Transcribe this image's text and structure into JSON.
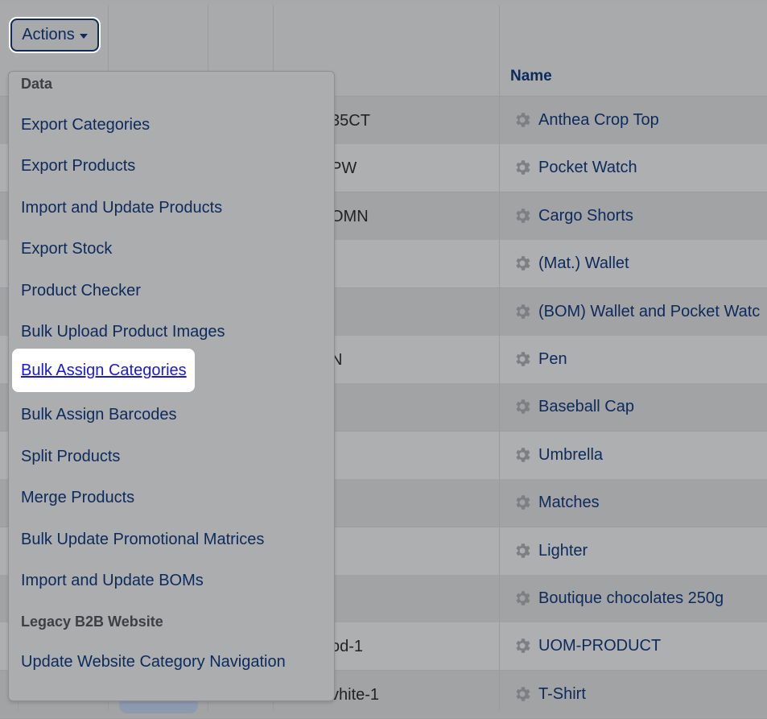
{
  "actions": {
    "label": "Actions"
  },
  "table": {
    "name_header": "Name",
    "rows": [
      {
        "sku": "35CT",
        "name": "Anthea Crop Top"
      },
      {
        "sku": "PW",
        "name": "Pocket Watch"
      },
      {
        "sku": "OMN",
        "name": "Cargo Shorts"
      },
      {
        "sku": "",
        "name": "(Mat.) Wallet"
      },
      {
        "sku": "",
        "name": "(BOM) Wallet and Pocket Watc"
      },
      {
        "sku": "N",
        "name": "Pen"
      },
      {
        "sku": "",
        "name": "Baseball Cap"
      },
      {
        "sku": "",
        "name": "Umbrella"
      },
      {
        "sku": "",
        "name": "Matches"
      },
      {
        "sku": "",
        "name": "Lighter"
      },
      {
        "sku": "",
        "name": "Boutique chocolates 250g"
      },
      {
        "sku": "od-1",
        "name": "UOM-PRODUCT"
      },
      {
        "sku": "vhite-1",
        "name": "T-Shirt"
      }
    ]
  },
  "menu": {
    "sections": [
      {
        "label": "Data"
      },
      {
        "label": "Legacy B2B Website"
      }
    ],
    "items": [
      {
        "label": "Export Categories"
      },
      {
        "label": "Export Products"
      },
      {
        "label": "Import and Update Products"
      },
      {
        "label": "Export Stock"
      },
      {
        "label": "Product Checker"
      },
      {
        "label": "Bulk Upload Product Images"
      },
      {
        "label": "Bulk Assign Categories",
        "state": "hovered"
      },
      {
        "label": "Bulk Assign Barcodes"
      },
      {
        "label": "Split Products"
      },
      {
        "label": "Merge Products"
      },
      {
        "label": "Bulk Update Promotional Matrices"
      },
      {
        "label": "Import and Update BOMs"
      },
      {
        "label": "Update Website Category Navigation"
      }
    ]
  },
  "icons": {
    "row_icon": "gear-icon",
    "dropdown_caret": "caret-down-icon"
  },
  "colors": {
    "text": "#0c2a5b",
    "highlight_bg": "#ffffff",
    "link_active": "#1a1ad6",
    "overlay_bg": "#a8a9ab"
  }
}
